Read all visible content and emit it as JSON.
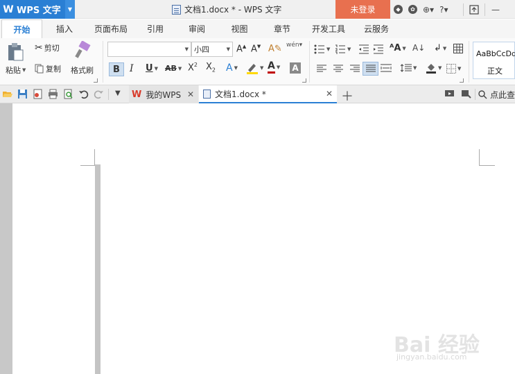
{
  "app": {
    "name": "WPS 文字"
  },
  "titlebar": {
    "document_title": "文档1.docx * - WPS 文字",
    "login_label": "未登录"
  },
  "tabs": [
    {
      "label": "开始",
      "active": true
    },
    {
      "label": "插入"
    },
    {
      "label": "页面布局"
    },
    {
      "label": "引用"
    },
    {
      "label": "审阅"
    },
    {
      "label": "视图"
    },
    {
      "label": "章节"
    },
    {
      "label": "开发工具"
    },
    {
      "label": "云服务"
    }
  ],
  "ribbon": {
    "paste_label": "粘贴",
    "cut_label": "剪切",
    "copy_label": "复制",
    "format_painter_label": "格式刷",
    "font_name": "",
    "font_size": "小四",
    "style_sample": "AaBbCcDd",
    "style_name": "正文"
  },
  "quick_access": {
    "tab_mywps": "我的WPS",
    "tab_doc": "文档1.docx *",
    "search_label": "点此查"
  },
  "watermark": {
    "brand": "Bai 经验",
    "url": "jingyan.baidu.com"
  },
  "colors": {
    "accent": "#2a7fd4",
    "login": "#e8704f",
    "font_color": "#c00000",
    "highlight": "#ffd800"
  }
}
